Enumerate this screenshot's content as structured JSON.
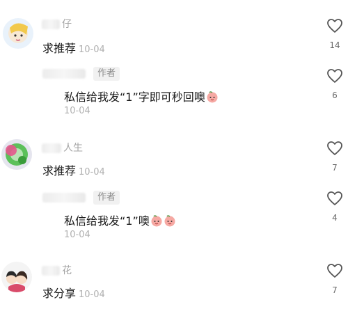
{
  "comments": [
    {
      "name_visible": "仔",
      "text": "求推荐",
      "date": "10-04",
      "likes": "14"
    },
    {
      "badge": "作者",
      "text": "私信给我发“1”字即可秒回噢",
      "date": "10-04",
      "likes": "6"
    },
    {
      "name_visible": "人生",
      "text": "求推荐",
      "date": "10-04",
      "likes": "7"
    },
    {
      "badge": "作者",
      "text": "私信给我发“1”噢",
      "date": "10-04",
      "likes": "4"
    },
    {
      "name_visible": "花",
      "text": "求分享",
      "date": "10-04",
      "likes": "7"
    }
  ],
  "icons": {
    "like": "heart-outline-icon",
    "emoji": "peach-face-emoji"
  },
  "colors": {
    "text": "#1a1a1a",
    "meta": "#b0b0b0",
    "heart": "#555555"
  }
}
